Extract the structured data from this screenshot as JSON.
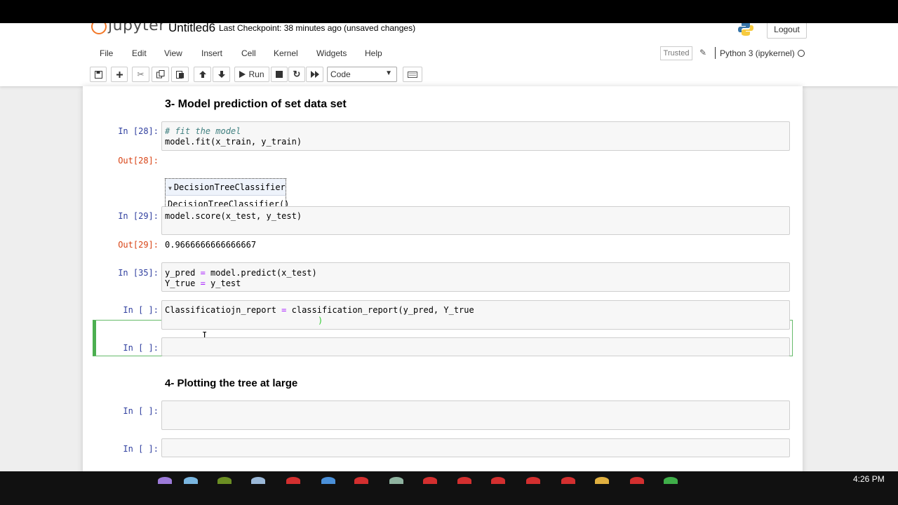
{
  "header": {
    "logo_text": "jupyter",
    "notebook_name": "Untitled6",
    "checkpoint": "Last Checkpoint: 38 minutes ago",
    "unsaved": "(unsaved changes)",
    "logout_label": "Logout"
  },
  "menu": {
    "items": [
      "File",
      "Edit",
      "View",
      "Insert",
      "Cell",
      "Kernel",
      "Widgets",
      "Help"
    ],
    "trusted": "Trusted",
    "kernel": "Python 3 (ipykernel)"
  },
  "toolbar": {
    "run_label": "Run",
    "cell_type": "Code"
  },
  "cells": {
    "heading3": "3- Model prediction of set data set",
    "c28": {
      "prompt": "In [28]:",
      "line1": "# fit the model",
      "line2": "model.fit(x_train, y_train)",
      "out_prompt": "Out[28]:",
      "estimator_title": "DecisionTreeClassifier",
      "estimator_repr": "DecisionTreeClassifier()"
    },
    "c29": {
      "prompt": "In [29]:",
      "line1": "model.score(x_test, y_test)",
      "out_prompt": "Out[29]:",
      "out_value": "0.9666666666666667"
    },
    "c35": {
      "prompt": "In [35]:",
      "line1_a": "y_pred ",
      "line1_op": "=",
      "line1_b": " model.predict(x_test)",
      "line2_a": "Y_true ",
      "line2_op": "=",
      "line2_b": " y_test"
    },
    "active": {
      "prompt": "In [ ]:",
      "line1_a": "Classificatiojn_report ",
      "line1_op": "=",
      "line1_b": " classification_report(y_pred, Y_true",
      "line2": ")"
    },
    "empty1_prompt": "In [ ]:",
    "heading4": "4- Plotting the tree at large",
    "empty2_prompt": "In [ ]:",
    "empty3_prompt": "In [ ]:"
  },
  "taskbar": {
    "clock": "4:26 PM"
  }
}
